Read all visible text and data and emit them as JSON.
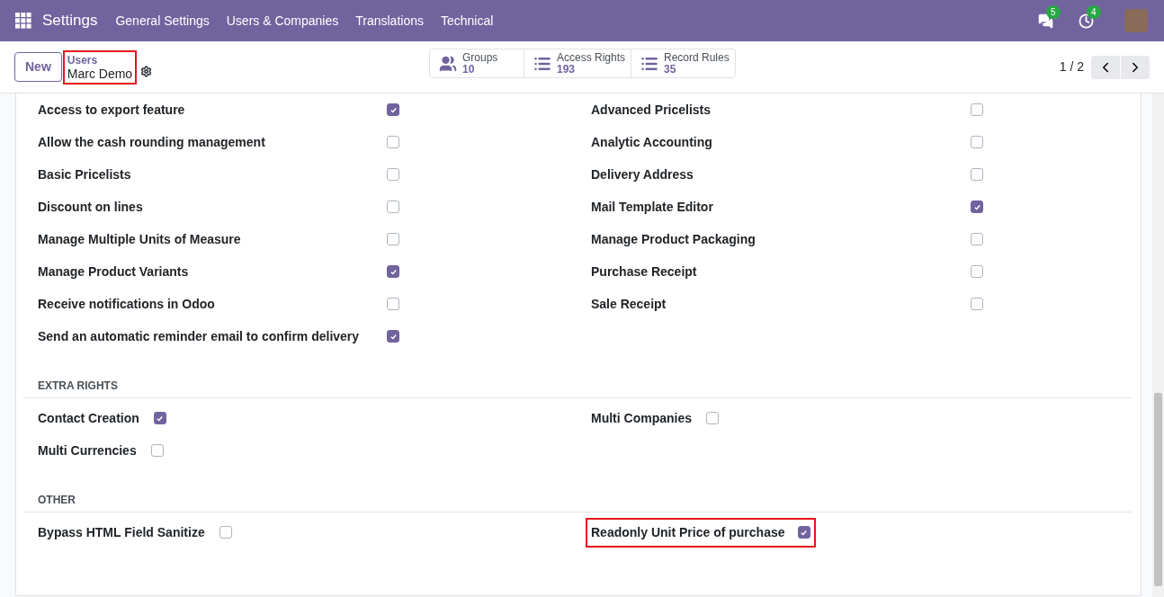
{
  "navbar": {
    "app_title": "Settings",
    "menu": [
      "General Settings",
      "Users & Companies",
      "Translations",
      "Technical"
    ],
    "chat_count": "5",
    "activity_count": "4"
  },
  "control_panel": {
    "new_button": "New",
    "breadcrumb": {
      "parent": "Users",
      "current": "Marc Demo",
      "highlighted": true
    },
    "stat_buttons": [
      {
        "kind": "groups",
        "label": "Groups",
        "value": "10"
      },
      {
        "kind": "list",
        "label": "Access Rights",
        "value": "193"
      },
      {
        "kind": "list",
        "label": "Record Rules",
        "value": "35"
      }
    ],
    "pager": "1 / 2"
  },
  "sections": [
    {
      "kind": "table",
      "columns": [
        [
          {
            "label": "Access to export feature",
            "checked": true,
            "highlighted": false
          },
          {
            "label": "Allow the cash rounding management",
            "checked": false,
            "highlighted": false
          },
          {
            "label": "Basic Pricelists",
            "checked": false,
            "highlighted": false
          },
          {
            "label": "Discount on lines",
            "checked": false,
            "highlighted": false
          },
          {
            "label": "Manage Multiple Units of Measure",
            "checked": false,
            "highlighted": false
          },
          {
            "label": "Manage Product Variants",
            "checked": true,
            "highlighted": false
          },
          {
            "label": "Receive notifications in Odoo",
            "checked": false,
            "highlighted": false
          },
          {
            "label": "Send an automatic reminder email to confirm delivery",
            "checked": true,
            "highlighted": false
          }
        ],
        [
          {
            "label": "Advanced Pricelists",
            "checked": false,
            "highlighted": false
          },
          {
            "label": "Analytic Accounting",
            "checked": false,
            "highlighted": false
          },
          {
            "label": "Delivery Address",
            "checked": false,
            "highlighted": false
          },
          {
            "label": "Mail Template Editor",
            "checked": true,
            "highlighted": false
          },
          {
            "label": "Manage Product Packaging",
            "checked": false,
            "highlighted": false
          },
          {
            "label": "Purchase Receipt",
            "checked": false,
            "highlighted": false
          },
          {
            "label": "Sale Receipt",
            "checked": false,
            "highlighted": false
          }
        ]
      ]
    },
    {
      "title": "EXTRA RIGHTS",
      "kind": "inline",
      "columns": [
        [
          {
            "label": "Contact Creation",
            "checked": true,
            "highlighted": false
          },
          {
            "label": "Multi Currencies",
            "checked": false,
            "highlighted": false
          }
        ],
        [
          {
            "label": "Multi Companies",
            "checked": false,
            "highlighted": false
          }
        ]
      ]
    },
    {
      "title": "OTHER",
      "kind": "inline",
      "columns": [
        [
          {
            "label": "Bypass HTML Field Sanitize",
            "checked": false,
            "highlighted": false
          }
        ],
        [
          {
            "label": "Readonly Unit Price of purchase",
            "checked": true,
            "highlighted": true
          }
        ]
      ]
    }
  ]
}
